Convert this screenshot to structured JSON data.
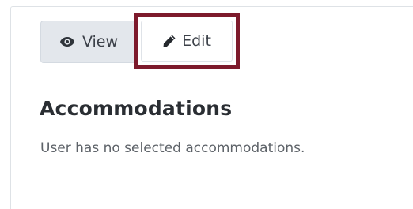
{
  "toolbar": {
    "view_label": "View",
    "view_icon": "eye-icon",
    "edit_label": "Edit",
    "edit_icon": "pencil-icon",
    "highlight_color": "#7d1a2c"
  },
  "section": {
    "title": "Accommodations",
    "message": "User has no selected accommodations."
  }
}
